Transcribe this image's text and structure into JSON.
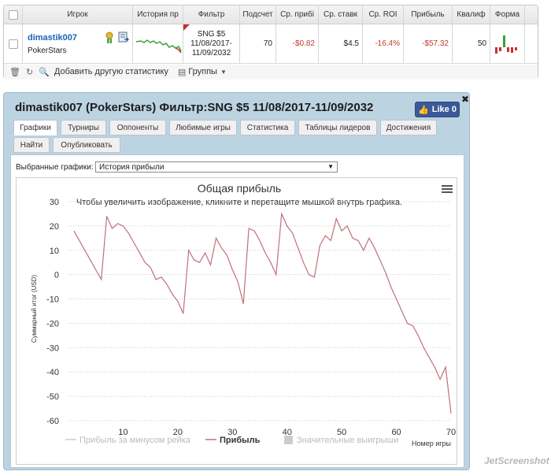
{
  "results_table": {
    "headers": [
      "Игрок",
      "История пр",
      "Фильтр",
      "Подсчет",
      "Ср. прибі",
      "Ср. ставк",
      "Ср. ROI",
      "Прибыль",
      "Квалиф",
      "Форма"
    ],
    "row": {
      "player": "dimastik007",
      "site": "PokerStars",
      "filter": [
        "SNG $5",
        "11/08/2017-",
        "11/09/2032"
      ],
      "count": "70",
      "avg_profit": "-$0.82",
      "avg_stake": "$4.5",
      "avg_roi": "-16.4%",
      "profit": "-$57.32",
      "qualify": "50"
    },
    "footer": {
      "add_stats": "Добавить другую статистику",
      "groups": "Группы"
    }
  },
  "dialog": {
    "title": "dimastik007 (PokerStars) Фильтр:SNG $5 11/08/2017-11/09/2032",
    "like_label": "Like 0",
    "tabs": [
      "Графики",
      "Турниры",
      "Оппоненты",
      "Любимые игры",
      "Статистика",
      "Таблицы лидеров",
      "Достижения",
      "Найти",
      "Опубликовать"
    ],
    "selected_graphs_label": "Выбранные графики:",
    "selected_graph": "История прибыли"
  },
  "chart_data": {
    "type": "line",
    "title": "Общая прибыль",
    "subtitle": "Чтобы увеличить изображение, кликните и перетащите мышкой внутрь графика.",
    "xlabel": "Номер игры",
    "ylabel": "Суммарный итог (USD)",
    "xlim": [
      0,
      70
    ],
    "ylim": [
      -60,
      30
    ],
    "x_ticks": [
      10,
      20,
      30,
      40,
      50,
      60,
      70
    ],
    "y_ticks": [
      30,
      20,
      10,
      0,
      -10,
      -20,
      -30,
      -40,
      -50,
      -60
    ],
    "legend_position": "bottom",
    "series": [
      {
        "name": "Прибыль за минусом рейка",
        "visible": false,
        "color": "#cccccc",
        "values": []
      },
      {
        "name": "Прибыль",
        "visible": true,
        "color": "#c0707a",
        "x": [
          1,
          2,
          3,
          4,
          5,
          6,
          7,
          8,
          9,
          10,
          11,
          12,
          13,
          14,
          15,
          16,
          17,
          18,
          19,
          20,
          21,
          22,
          23,
          24,
          25,
          26,
          27,
          28,
          29,
          30,
          31,
          32,
          33,
          34,
          35,
          36,
          37,
          38,
          39,
          40,
          41,
          42,
          43,
          44,
          45,
          46,
          47,
          48,
          49,
          50,
          51,
          52,
          53,
          54,
          55,
          56,
          57,
          58,
          59,
          60,
          61,
          62,
          63,
          64,
          65,
          66,
          67,
          68,
          69,
          70
        ],
        "values": [
          18,
          14,
          10,
          6,
          2,
          -2,
          24,
          19,
          21,
          20,
          17,
          13,
          9,
          5,
          3,
          -2,
          -1,
          -4,
          -8,
          -11,
          -16,
          10,
          6,
          5,
          9,
          4,
          15,
          11,
          8,
          2,
          -3,
          -12,
          19,
          18,
          14,
          9,
          5,
          0,
          25,
          20,
          17,
          11,
          5,
          0,
          -1,
          12,
          16,
          14,
          23,
          18,
          20,
          15,
          14,
          10,
          15,
          11,
          6,
          1,
          -5,
          -10,
          -15,
          -20,
          -21,
          -25,
          -30,
          -34,
          -38,
          -43,
          -38,
          -57
        ]
      },
      {
        "name": "Значительные выигрыши",
        "visible": false,
        "color": "#cccccc",
        "values": []
      }
    ]
  },
  "watermark": "JetScreenshot"
}
